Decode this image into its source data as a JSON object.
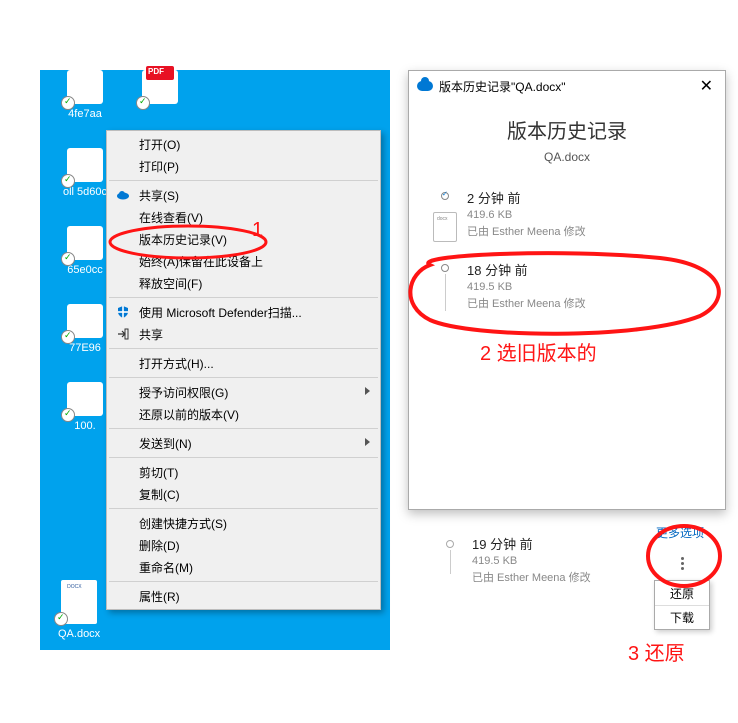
{
  "desktop": {
    "icons": [
      {
        "label": "4fe7aa"
      },
      {
        "label": "oll 5d60c"
      },
      {
        "label": "65e0cc"
      },
      {
        "label": "77E96"
      },
      {
        "label": "100."
      }
    ],
    "qa_file": "QA.docx"
  },
  "context_menu": {
    "open": "打开(O)",
    "print": "打印(P)",
    "share": "共享(S)",
    "view_online": "在线查看(V)",
    "version_history": "版本历史记录(V)",
    "always_keep": "始终(A)保留在此设备上",
    "free_space": "释放空间(F)",
    "defender": "使用 Microsoft Defender扫描...",
    "share2": "共享",
    "open_with": "打开方式(H)...",
    "grant_access": "授予访问权限(G)",
    "previous_versions": "还原以前的版本(V)",
    "send_to": "发送到(N)",
    "cut": "剪切(T)",
    "copy": "复制(C)",
    "create_shortcut": "创建快捷方式(S)",
    "delete": "删除(D)",
    "rename": "重命名(M)",
    "properties": "属性(R)"
  },
  "panel": {
    "window_title": "版本历史记录\"QA.docx\"",
    "heading": "版本历史记录",
    "filename": "QA.docx",
    "versions": [
      {
        "time": "2 分钟 前",
        "size": "419.6 KB",
        "author": "已由 Esther Meena 修改"
      },
      {
        "time": "18 分钟 前",
        "size": "419.5 KB",
        "author": "已由 Esther Meena 修改"
      }
    ]
  },
  "row3": {
    "time": "19 分钟 前",
    "size": "419.5 KB",
    "author": "已由 Esther Meena 修改",
    "more_options": "更多选项"
  },
  "mini_menu": {
    "restore": "还原",
    "download": "下载"
  },
  "annotations": {
    "n1": "1",
    "n2": "2 选旧版本的",
    "n3": "3 还原"
  }
}
